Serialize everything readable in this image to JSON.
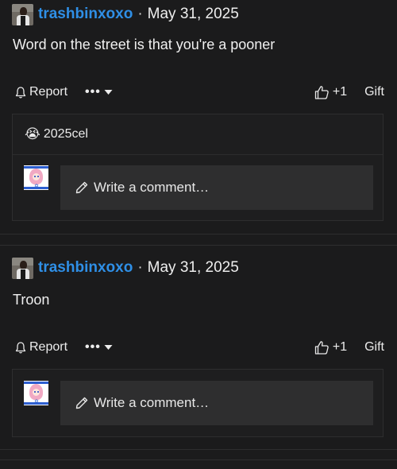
{
  "posts": [
    {
      "author": "trashbinxoxo",
      "separator": "·",
      "date": "May 31, 2025",
      "body": "Word on the street is that you're a pooner",
      "actions": {
        "report": "Report",
        "more": "•••",
        "plus": "+1",
        "gift": "Gift"
      },
      "comments": {
        "flair_emoji": "😭",
        "flair_text": "2025cel",
        "write_placeholder": "Write a comment…"
      }
    },
    {
      "author": "trashbinxoxo",
      "separator": "·",
      "date": "May 31, 2025",
      "body": "Troon",
      "actions": {
        "report": "Report",
        "more": "•••",
        "plus": "+1",
        "gift": "Gift"
      },
      "comments": {
        "write_placeholder": "Write a comment…"
      }
    }
  ],
  "colors": {
    "background": "#1b1b1c",
    "username": "#2f8fe6",
    "panel": "#2e2e2f"
  },
  "icons": {
    "report": "bell-icon",
    "more": "more-dots-icon",
    "dropdown": "caret-down-icon",
    "like": "thumbs-up-icon",
    "write": "pencil-icon"
  }
}
